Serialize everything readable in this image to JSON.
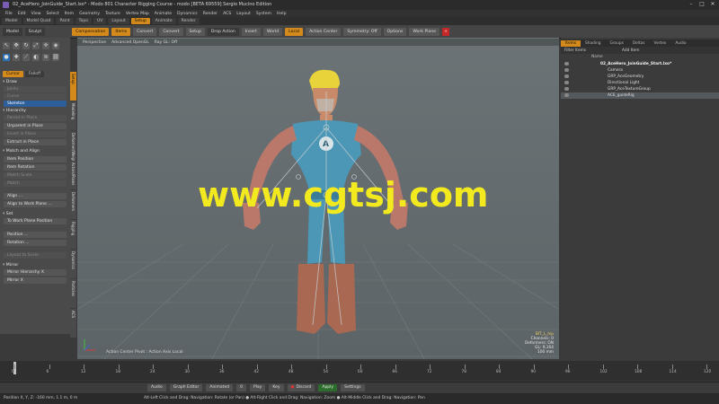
{
  "window": {
    "title": "02_AceHero_JoinGuide_Start.lxo* - Modo 801 Character Rigging Course - modo [BETA 69559] Sergio Mucino Edition",
    "min_glyph": "–",
    "max_glyph": "□",
    "close_glyph": "✕"
  },
  "menu": [
    "File",
    "Edit",
    "View",
    "Select",
    "Item",
    "Geometry",
    "Texture",
    "Vertex Map",
    "Animate",
    "Dynamics",
    "Render",
    "ACS",
    "Layout",
    "System",
    "Help"
  ],
  "layout_tabs": [
    {
      "label": "Model",
      "active": false
    },
    {
      "label": "Model Quad",
      "active": false
    },
    {
      "label": "Paint",
      "active": false
    },
    {
      "label": "Topo",
      "active": false
    },
    {
      "label": "UV",
      "active": false
    },
    {
      "label": "Layout",
      "active": false
    },
    {
      "label": "Setup",
      "active": true
    },
    {
      "label": "Animate",
      "active": false
    },
    {
      "label": "Render",
      "active": false
    }
  ],
  "toolbar": {
    "model": "Model",
    "sculpt": "Sculpt",
    "compensation": "Compensation",
    "items": "Items",
    "convert": "Convert",
    "convert2": "Convert",
    "setup": "Setup",
    "drop_action": "Drop Action",
    "insert": "Insert",
    "world": "World",
    "local": "Local",
    "action_center": "Action Center",
    "symmetry": "Symmetry: Off",
    "options": "Options",
    "work_plane": "Work Plane",
    "plus": "+"
  },
  "left_panel": {
    "tab_left": "Cursor",
    "tab_right": "Falloff",
    "draw_section": "Draw",
    "draw_buttons": [
      "Joints",
      "Curve"
    ],
    "skeleton": "Skeleton",
    "hierarchy_section": "Hierarchy",
    "hierarchy_buttons": [
      "Parent in Place",
      "Unparent in Place",
      "Insert in Place",
      "Extract in Place"
    ],
    "match_section": "Match and Align",
    "match_buttons": [
      "Item Position",
      "Item Rotation",
      "Match Scale",
      "Match"
    ],
    "align_buttons": [
      "Align ...",
      "Align to Work Plane ..."
    ],
    "set_section": "Set",
    "set_button": "To Work Plane Position",
    "position_button": "Position ...",
    "rotation_button": "Rotation ...",
    "layout_button": "Layout to Scale",
    "mirror_section": "Mirror",
    "mirror_buttons": [
      "Mirror Hierarchy X",
      "Mirror X"
    ],
    "vertical_tabs": [
      "Setup",
      "Modeling",
      "Deformer/Weights",
      "Actors/Poses",
      "Deformers",
      "Rigging",
      "Dynamics",
      "Particles",
      "ACS"
    ]
  },
  "viewport": {
    "header": [
      "Perspective",
      "Advanced OpenGL",
      "Ray GL: Off"
    ],
    "stats": {
      "selection": "BIT_L_hip",
      "channels": "Channels: 0",
      "deformers": "Deformers: ON",
      "gl": "GL: 9,164",
      "units": "100 mm"
    },
    "footer": "Action Center Pivot : Action Axis Local",
    "watermark": "www.cgtsj.com"
  },
  "right_panel": {
    "tabs": [
      {
        "label": "Items",
        "active": true
      },
      {
        "label": "Shading",
        "active": false
      },
      {
        "label": "Groups",
        "active": false
      },
      {
        "label": "Deltas",
        "active": false
      },
      {
        "label": "Vertex",
        "active": false
      },
      {
        "label": "Audio",
        "active": false
      }
    ],
    "filter": "Filter Items",
    "add_item": "Add Item",
    "column_name": "Name",
    "tree": [
      {
        "label": "02_AceHero_JoinGuide_Start.lxo*",
        "indent": 0,
        "root": true,
        "sel": false
      },
      {
        "label": "Camera",
        "indent": 1,
        "root": false,
        "sel": false
      },
      {
        "label": "GRP_AceGeometry",
        "indent": 1,
        "root": false,
        "sel": false
      },
      {
        "label": "Directional Light",
        "indent": 1,
        "root": false,
        "sel": false
      },
      {
        "label": "GRP_AceTextureGroup",
        "indent": 1,
        "root": false,
        "sel": false
      },
      {
        "label": "ACE_guideRig",
        "indent": 1,
        "root": false,
        "sel": true
      }
    ]
  },
  "timeline": {
    "start": 0,
    "end": 120,
    "current": 0,
    "labels": [
      "0",
      "6",
      "12",
      "18",
      "24",
      "30",
      "36",
      "42",
      "48",
      "54",
      "60",
      "66",
      "72",
      "78",
      "84",
      "90",
      "96",
      "102",
      "108",
      "114",
      "120"
    ]
  },
  "transport": {
    "audio": "Audio",
    "graph_editor": "Graph Editor",
    "animated": "Animated",
    "frame": "0",
    "play": "Play",
    "key": "Key",
    "discard": "Discard",
    "apply": "Apply",
    "settings": "Settings"
  },
  "status": {
    "position": "Position X, Y, Z:   -160 mm, 1.1 m, 0 m",
    "hint": "Alt-Left Click and Drag: Navigation: Rotate (or Pan)  ●  Alt-Right Click and Drag: Navigation: Zoom  ●  Alt-Middle Click and Drag: Navigation: Pan"
  },
  "colors": {
    "accent": "#d48a1a",
    "viewport_bg": "#656d70",
    "watermark": "#f2ea1f",
    "selection_blue": "#2d5f9a"
  }
}
